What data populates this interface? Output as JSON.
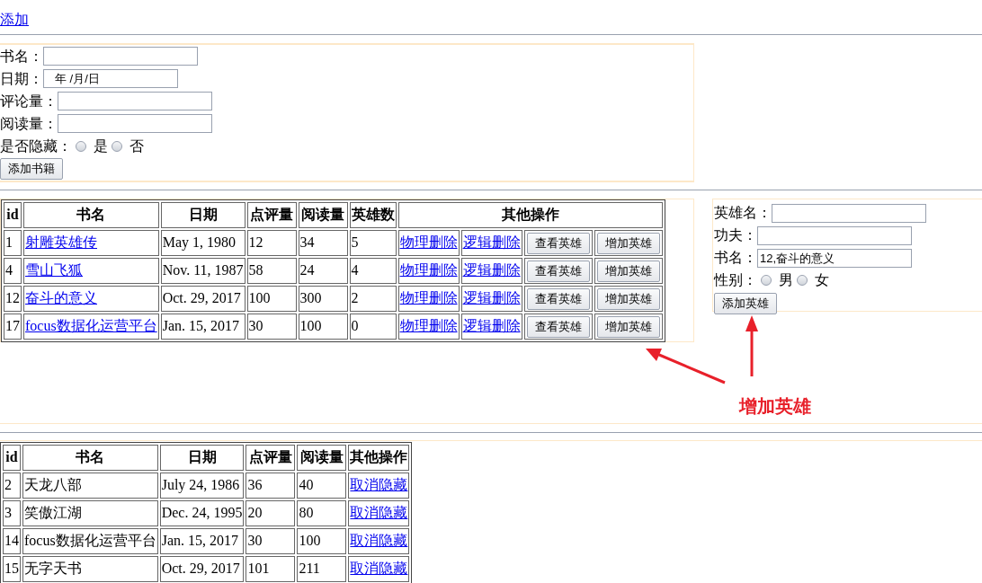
{
  "top_link": "添加",
  "book_form": {
    "fields": [
      {
        "label": "书名：",
        "kind": "text"
      },
      {
        "label": "日期：",
        "kind": "date",
        "value": "年 /月/日"
      },
      {
        "label": "评论量：",
        "kind": "text"
      },
      {
        "label": "阅读量：",
        "kind": "text"
      }
    ],
    "hidden": {
      "label": "是否隐藏：",
      "options": [
        {
          "label": "是",
          "checked": false
        },
        {
          "label": "否",
          "checked": false
        }
      ]
    },
    "submit": "添加书籍"
  },
  "books_table": {
    "columns": [
      "id",
      "书名",
      "日期",
      "点评量",
      "阅读量",
      "英雄数",
      "其他操作"
    ],
    "rows": [
      {
        "id": "1",
        "name": "射雕英雄传",
        "date": "May 1, 1980",
        "reviews": "12",
        "reads": "34",
        "heroes": "5",
        "links": [
          "物理删除",
          "逻辑删除"
        ],
        "buttons": [
          "查看英雄",
          "增加英雄"
        ]
      },
      {
        "id": "4",
        "name": "雪山飞狐",
        "date": "Nov. 11, 1987",
        "reviews": "58",
        "reads": "24",
        "heroes": "4",
        "links": [
          "物理删除",
          "逻辑删除"
        ],
        "buttons": [
          "查看英雄",
          "增加英雄"
        ]
      },
      {
        "id": "12",
        "name": "奋斗的意义",
        "date": "Oct. 29, 2017",
        "reviews": "100",
        "reads": "300",
        "heroes": "2",
        "links": [
          "物理删除",
          "逻辑删除"
        ],
        "buttons": [
          "查看英雄",
          "增加英雄"
        ]
      },
      {
        "id": "17",
        "name": "focus数据化运营平台",
        "date": "Jan. 15, 2017",
        "reviews": "30",
        "reads": "100",
        "heroes": "0",
        "links": [
          "物理删除",
          "逻辑删除"
        ],
        "buttons": [
          "查看英雄",
          "增加英雄"
        ]
      }
    ]
  },
  "hero_form": {
    "fields": [
      {
        "label": "英雄名："
      },
      {
        "label": "功夫："
      },
      {
        "label": "书名：",
        "value": "12,奋斗的意义"
      }
    ],
    "gender": {
      "label": "性别：",
      "options": [
        {
          "label": "男",
          "checked": false
        },
        {
          "label": "女",
          "checked": false
        }
      ]
    },
    "submit": "添加英雄"
  },
  "annotation": {
    "text": "增加英雄"
  },
  "hidden_table": {
    "columns": [
      "id",
      "书名",
      "日期",
      "点评量",
      "阅读量",
      "其他操作"
    ],
    "rows": [
      {
        "id": "2",
        "name": "天龙八部",
        "date": "July 24, 1986",
        "reviews": "36",
        "reads": "40",
        "link": "取消隐藏"
      },
      {
        "id": "3",
        "name": "笑傲江湖",
        "date": "Dec. 24, 1995",
        "reviews": "20",
        "reads": "80",
        "link": "取消隐藏"
      },
      {
        "id": "14",
        "name": "focus数据化运营平台",
        "date": "Jan. 15, 2017",
        "reviews": "30",
        "reads": "100",
        "link": "取消隐藏"
      },
      {
        "id": "15",
        "name": "无字天书",
        "date": "Oct. 29, 2017",
        "reviews": "101",
        "reads": "211",
        "link": "取消隐藏"
      }
    ]
  }
}
